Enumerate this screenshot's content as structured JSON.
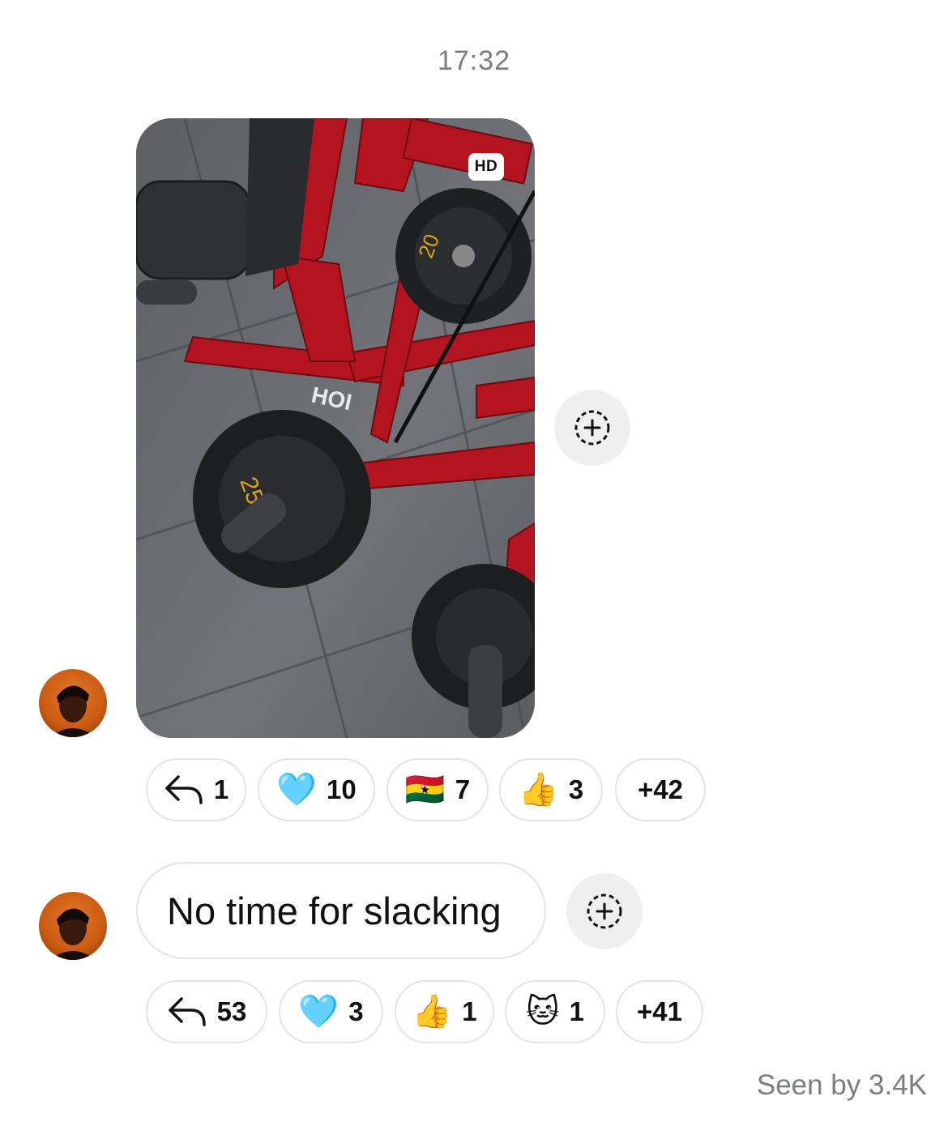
{
  "timestamp": "17:32",
  "photo": {
    "badge": "HD",
    "plate_label_1": "25",
    "plate_label_2": "20",
    "brand_text": "HOI"
  },
  "message1_reactions": [
    {
      "icon": "reply-arrow-icon",
      "emoji": "",
      "count": "1"
    },
    {
      "icon": "",
      "emoji": "🩵",
      "count": "10"
    },
    {
      "icon": "",
      "emoji": "🇬🇭",
      "count": "7"
    },
    {
      "icon": "",
      "emoji": "👍",
      "count": "3"
    },
    {
      "icon": "",
      "emoji": "",
      "count": "+42"
    }
  ],
  "message2": {
    "text": "No time for slacking"
  },
  "message2_reactions": [
    {
      "icon": "reply-arrow-icon",
      "emoji": "",
      "count": "53"
    },
    {
      "icon": "",
      "emoji": "🩵",
      "count": "3"
    },
    {
      "icon": "",
      "emoji": "👍",
      "count": "1"
    },
    {
      "icon": "",
      "emoji": "🐱",
      "count": "1"
    },
    {
      "icon": "",
      "emoji": "",
      "count": "+41"
    }
  ],
  "seen_by": "Seen by 3.4K"
}
